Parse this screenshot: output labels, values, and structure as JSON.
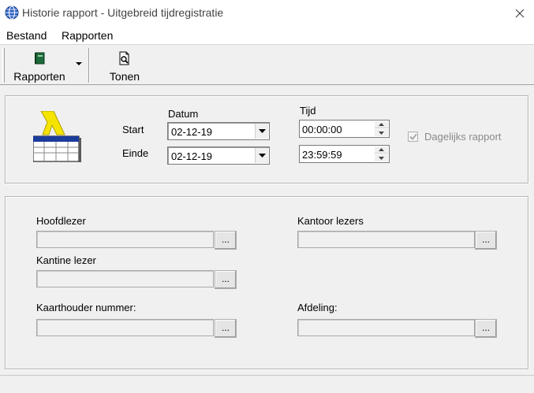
{
  "window": {
    "title": "Historie rapport - Uitgebreid tijdregistratie",
    "close_symbol": "✕",
    "icon": "globe-icon"
  },
  "menu": {
    "items": [
      {
        "label": "Bestand"
      },
      {
        "label": "Rapporten"
      }
    ]
  },
  "toolbar": {
    "rapporten_label": "Rapporten",
    "tonen_label": "Tonen",
    "rapporten_icon": "book-icon",
    "tonen_icon": "print-preview-icon"
  },
  "period": {
    "datum_header": "Datum",
    "tijd_header": "Tijd",
    "start_label": "Start",
    "einde_label": "Einde",
    "start_date": "02-12-19",
    "end_date": "02-12-19",
    "start_time": "00:00:00",
    "end_time": "23:59:59",
    "daily_report_label": "Dagelijks rapport",
    "daily_report_checked": true,
    "daily_report_enabled": false
  },
  "filters": {
    "hoofdlezer_label": "Hoofdlezer",
    "hoofdlezer_value": "",
    "kantoor_label": "Kantoor lezers",
    "kantoor_value": "",
    "kantine_label": "Kantine lezer",
    "kantine_value": "",
    "kaarthouder_label": "Kaarthouder nummer:",
    "kaarthouder_value": "",
    "afdeling_label": "Afdeling:",
    "afdeling_value": "",
    "browse_label": "..."
  },
  "colors": {
    "accent_yellow": "#f5e400",
    "report_blue": "#1c3c9c"
  }
}
